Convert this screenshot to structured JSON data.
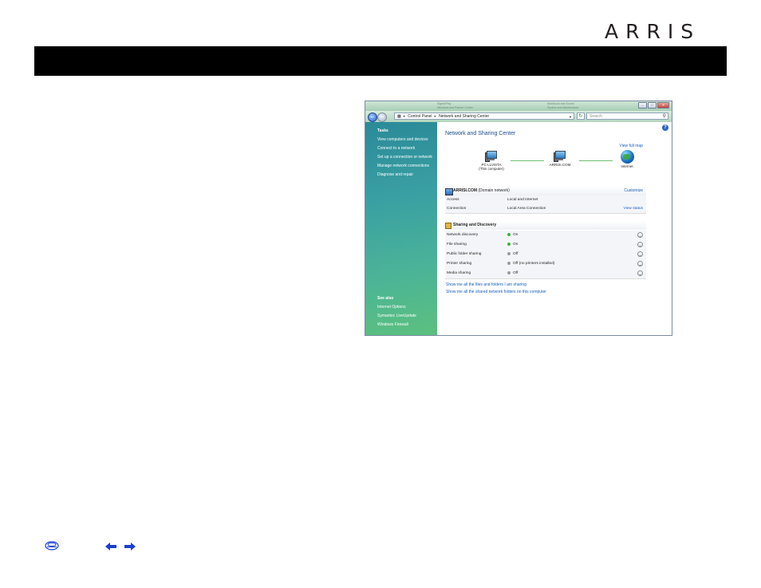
{
  "logo": "ARRIS",
  "window": {
    "address": {
      "segment1": "Control Panel",
      "segment2": "Network and Sharing Center"
    },
    "search_placeholder": "Search",
    "help_glyph": "?",
    "background_titles": [
      "Signal/Play",
      "Windows and Partner Center",
      "Workbook and Sound",
      "System and Maintenance"
    ]
  },
  "sidebar": {
    "tasks_heading": "Tasks",
    "tasks": [
      "View computers and devices",
      "Connect to a network",
      "Set up a connection or network",
      "Manage network connections",
      "Diagnose and repair"
    ],
    "see_also_heading": "See also",
    "see_also": [
      "Internet Options",
      "Symantec LiveUpdate",
      "Windows Firewall"
    ]
  },
  "content": {
    "title": "Network and Sharing Center",
    "view_full_map": "View full map",
    "nodes": {
      "computer_name": "PC-LLVISTA",
      "computer_sub": "(This computer)",
      "network_name": "ARRISI.COM",
      "internet": "Internet"
    },
    "network": {
      "name": "ARRISI.COM",
      "type": "(Domain network)",
      "customize": "Customize",
      "rows": [
        {
          "label": "Access",
          "value": "Local and Internet",
          "action": ""
        },
        {
          "label": "Connection",
          "value": "Local Area Connection",
          "action": "View status"
        }
      ]
    },
    "sharing": {
      "heading": "Sharing and Discovery",
      "rows": [
        {
          "label": "Network discovery",
          "value": "On",
          "state": "on"
        },
        {
          "label": "File sharing",
          "value": "On",
          "state": "on"
        },
        {
          "label": "Public folder sharing",
          "value": "Off",
          "state": "off"
        },
        {
          "label": "Printer sharing",
          "value": "Off (no printers installed)",
          "state": "off"
        },
        {
          "label": "Media sharing",
          "value": "Off",
          "state": "off"
        }
      ]
    },
    "links": [
      "Show me all the files and folders I am sharing",
      "Show me all the shared network folders on this computer"
    ]
  },
  "colors": {
    "footer_icon": "#1a3fd0"
  }
}
